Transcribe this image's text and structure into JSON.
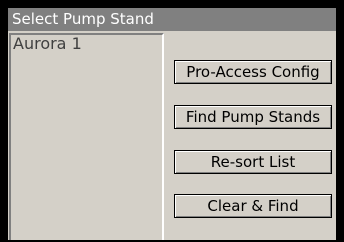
{
  "window": {
    "title": "Select Pump Stand"
  },
  "list": {
    "items": [
      "Aurora 1"
    ]
  },
  "buttons": {
    "pro_access_config": "Pro-Access Config",
    "find_pump_stands": "Find Pump Stands",
    "resort_list": "Re-sort List",
    "clear_and_find": "Clear & Find"
  }
}
